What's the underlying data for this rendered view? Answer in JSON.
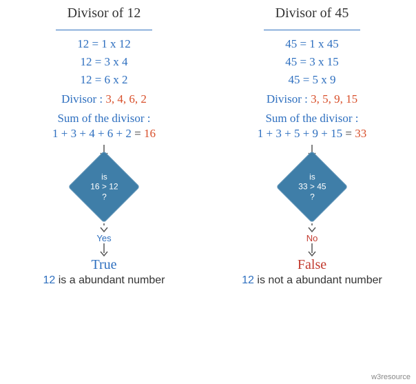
{
  "watermark": "w3resource",
  "left": {
    "title": "Divisor of 12",
    "factorizations": [
      "12 = 1 x 12",
      "12 = 3 x 4",
      "12 = 6 x 2"
    ],
    "divisor_label": "Divisor : ",
    "divisor_values": "3, 4, 6, 2",
    "sum_label": "Sum of the divisor :",
    "sum_terms": "1 + 3 + 4 + 6 + 2",
    "sum_total": "16",
    "decision_l1": "is",
    "decision_l2": "16 > 12",
    "decision_l3": "?",
    "branch_label": "Yes",
    "result": "True",
    "conclusion_num": "12",
    "conclusion_rest": " is a abundant number"
  },
  "right": {
    "title": "Divisor of 45",
    "factorizations": [
      "45 = 1 x 45",
      "45 = 3 x 15",
      "45 = 5 x 9"
    ],
    "divisor_label": "Divisor : ",
    "divisor_values": "3, 5, 9, 15",
    "sum_label": "Sum of the divisor :",
    "sum_terms": "1 + 3 + 5 + 9 + 15",
    "sum_total": "33",
    "decision_l1": "is",
    "decision_l2": "33 > 45",
    "decision_l3": "?",
    "branch_label": "No",
    "result": "False",
    "conclusion_num": "12",
    "conclusion_rest": " is not a abundant number"
  },
  "chart_data": {
    "type": "table",
    "title": "Abundant number check",
    "series": [
      {
        "name": "Divisor of 12",
        "n": 12,
        "factorizations": [
          "1x12",
          "3x4",
          "6x2"
        ],
        "proper_divisors_listed": [
          3,
          4,
          6,
          2
        ],
        "sum_shown": 16,
        "comparison": "16 > 12",
        "result": true
      },
      {
        "name": "Divisor of 45",
        "n": 45,
        "factorizations": [
          "1x45",
          "3x15",
          "5x9"
        ],
        "proper_divisors_listed": [
          3,
          5,
          9,
          15
        ],
        "sum_shown": 33,
        "comparison": "33 > 45",
        "result": false
      }
    ]
  }
}
